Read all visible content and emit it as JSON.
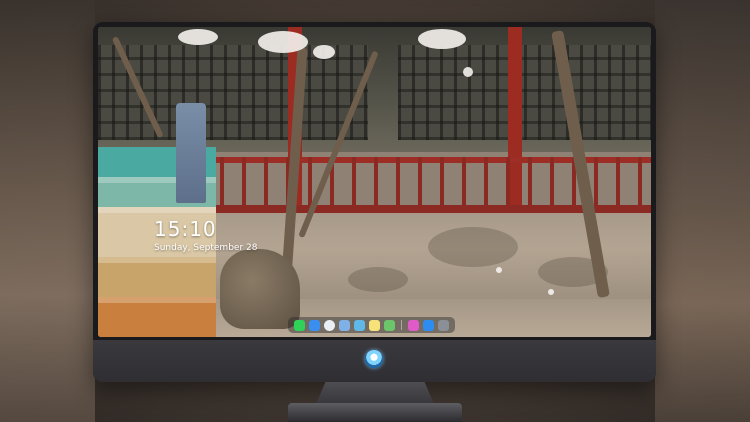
{
  "lockscreen": {
    "time": "15:10",
    "date": "Sunday, September 28"
  },
  "dock": {
    "icons": [
      {
        "name": "messages-icon",
        "color": "#2fd158"
      },
      {
        "name": "finder-icon",
        "color": "#3a8ef0"
      },
      {
        "name": "safari-icon",
        "color": "#e9eef5"
      },
      {
        "name": "preview-icon",
        "color": "#7fb0e6"
      },
      {
        "name": "claquette-icon",
        "color": "#5fb8e8"
      },
      {
        "name": "notes-icon",
        "color": "#f7e27a"
      },
      {
        "name": "photos-icon",
        "color": "#6cc46b"
      },
      {
        "name": "itunes-icon",
        "color": "#e05ac8"
      },
      {
        "name": "app-store-icon",
        "color": "#2d8cf0"
      },
      {
        "name": "screenshot-icon",
        "color": "#8a8f98"
      }
    ]
  },
  "monitor": {
    "logo": "monitor-logo-icon"
  }
}
